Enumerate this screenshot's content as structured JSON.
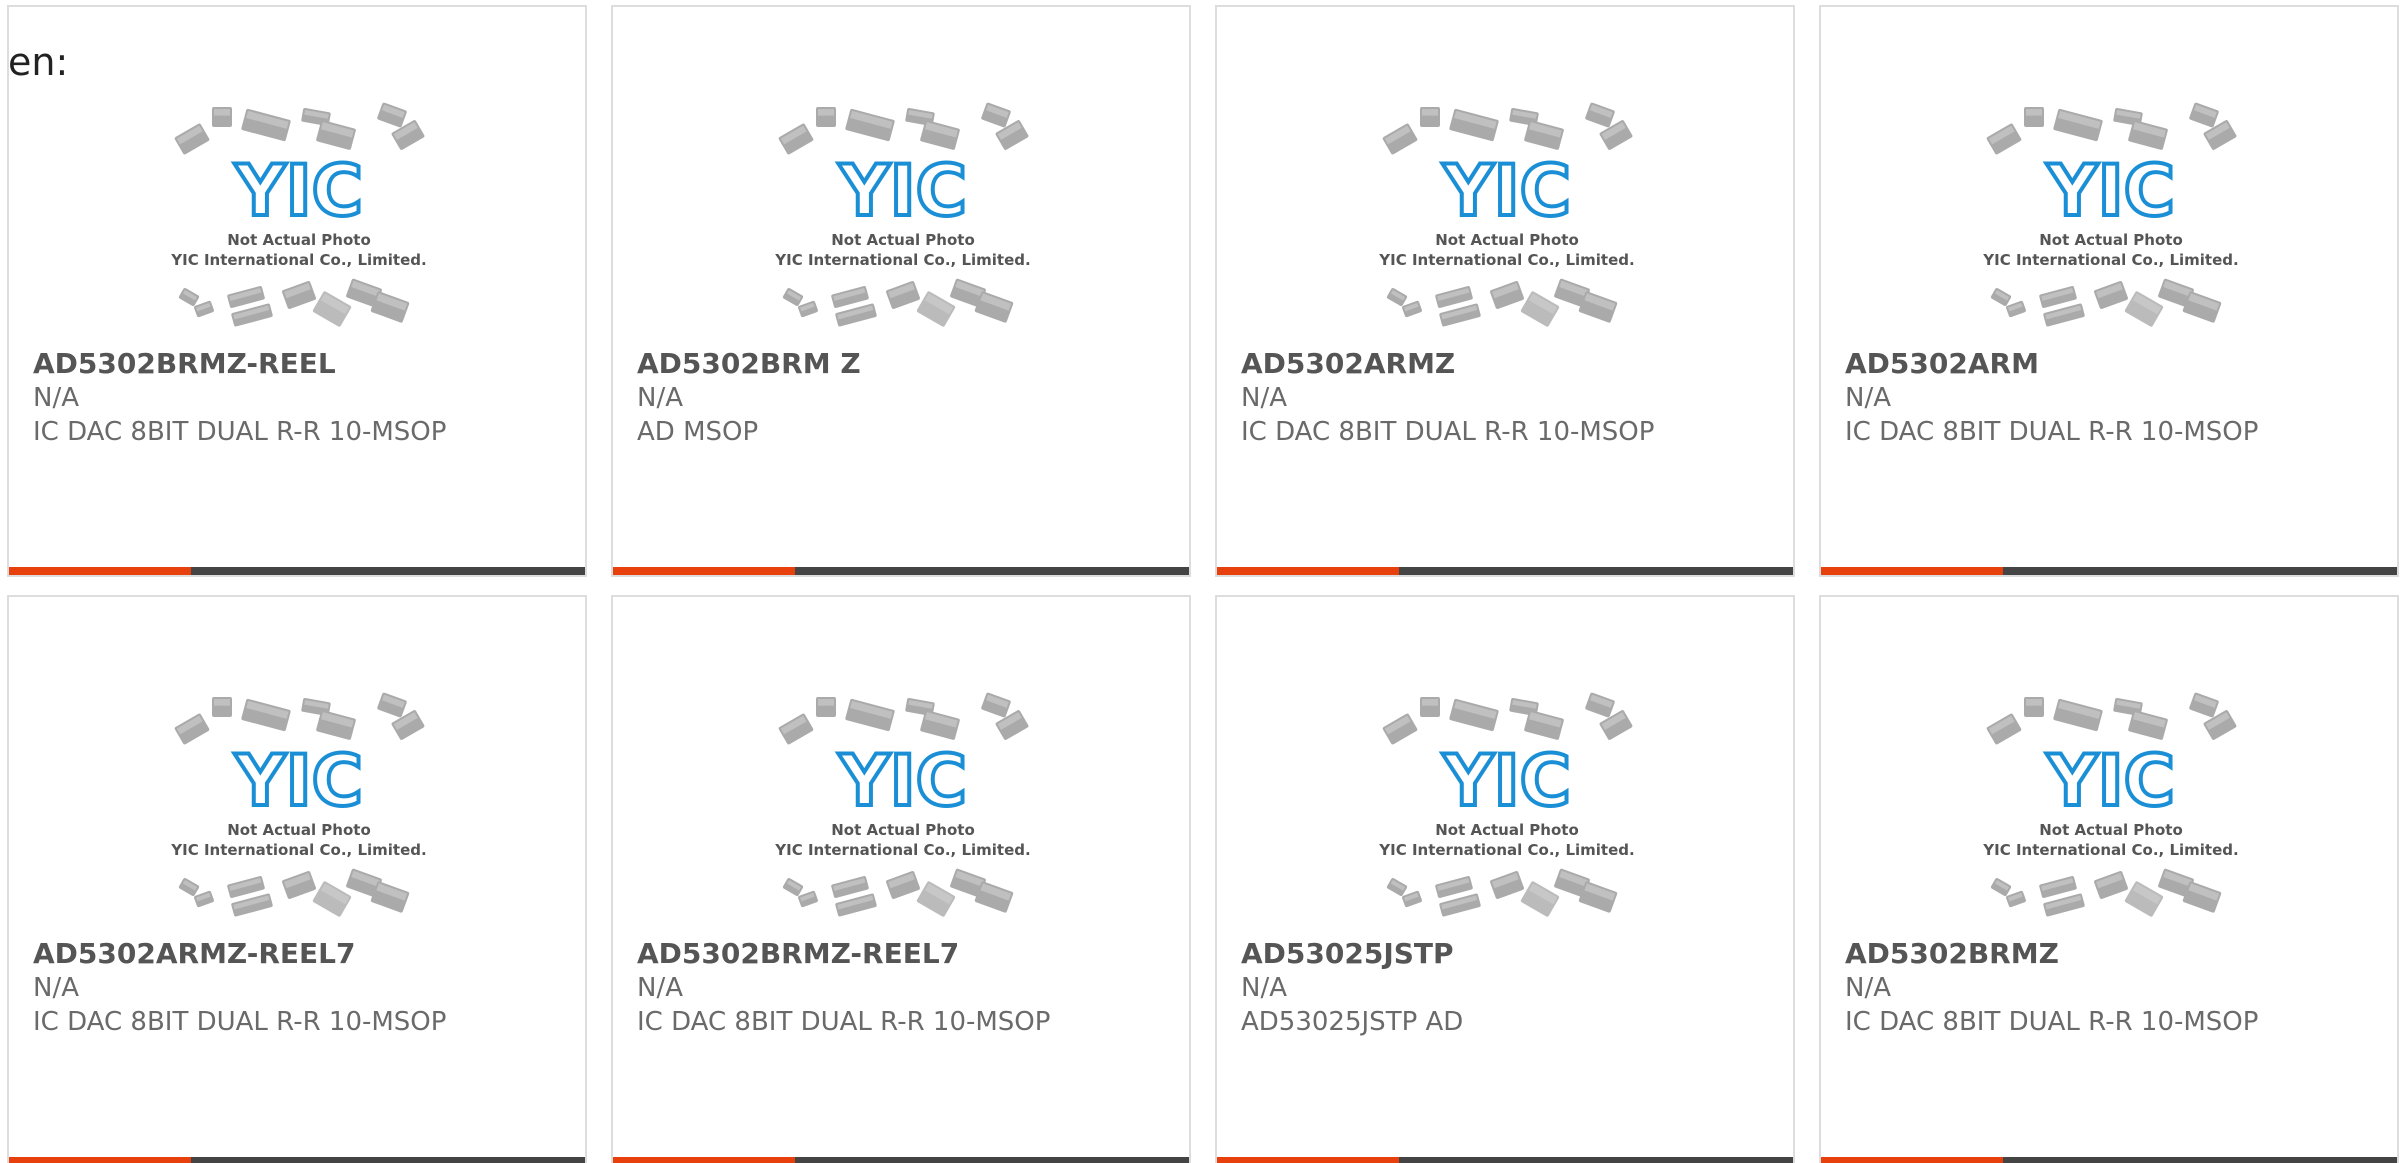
{
  "header": {
    "label": "en:"
  },
  "placeholder": {
    "line1": "Not Actual Photo",
    "line2": "YIC International Co., Limited.",
    "logo_text": "YIC"
  },
  "colors": {
    "accent": "#e8400c",
    "bar": "#444444",
    "logo": "#1b8fd6",
    "chip": "#aaaaaa"
  },
  "products": [
    {
      "part": "AD5302BRMZ-REEL",
      "mfr": "N/A",
      "desc": "IC DAC 8BIT DUAL R-R 10-MSOP"
    },
    {
      "part": "AD5302BRM Z",
      "mfr": "N/A",
      "desc": "AD MSOP"
    },
    {
      "part": "AD5302ARMZ",
      "mfr": "N/A",
      "desc": "IC DAC 8BIT DUAL R-R 10-MSOP"
    },
    {
      "part": "AD5302ARM",
      "mfr": "N/A",
      "desc": "IC DAC 8BIT DUAL R-R 10-MSOP"
    },
    {
      "part": "AD5302ARMZ-REEL7",
      "mfr": "N/A",
      "desc": "IC DAC 8BIT DUAL R-R 10-MSOP"
    },
    {
      "part": "AD5302BRMZ-REEL7",
      "mfr": "N/A",
      "desc": "IC DAC 8BIT DUAL R-R 10-MSOP"
    },
    {
      "part": "AD53025JSTP",
      "mfr": "N/A",
      "desc": "AD53025JSTP AD"
    },
    {
      "part": "AD5302BRMZ",
      "mfr": "N/A",
      "desc": "IC DAC 8BIT DUAL R-R 10-MSOP"
    }
  ]
}
